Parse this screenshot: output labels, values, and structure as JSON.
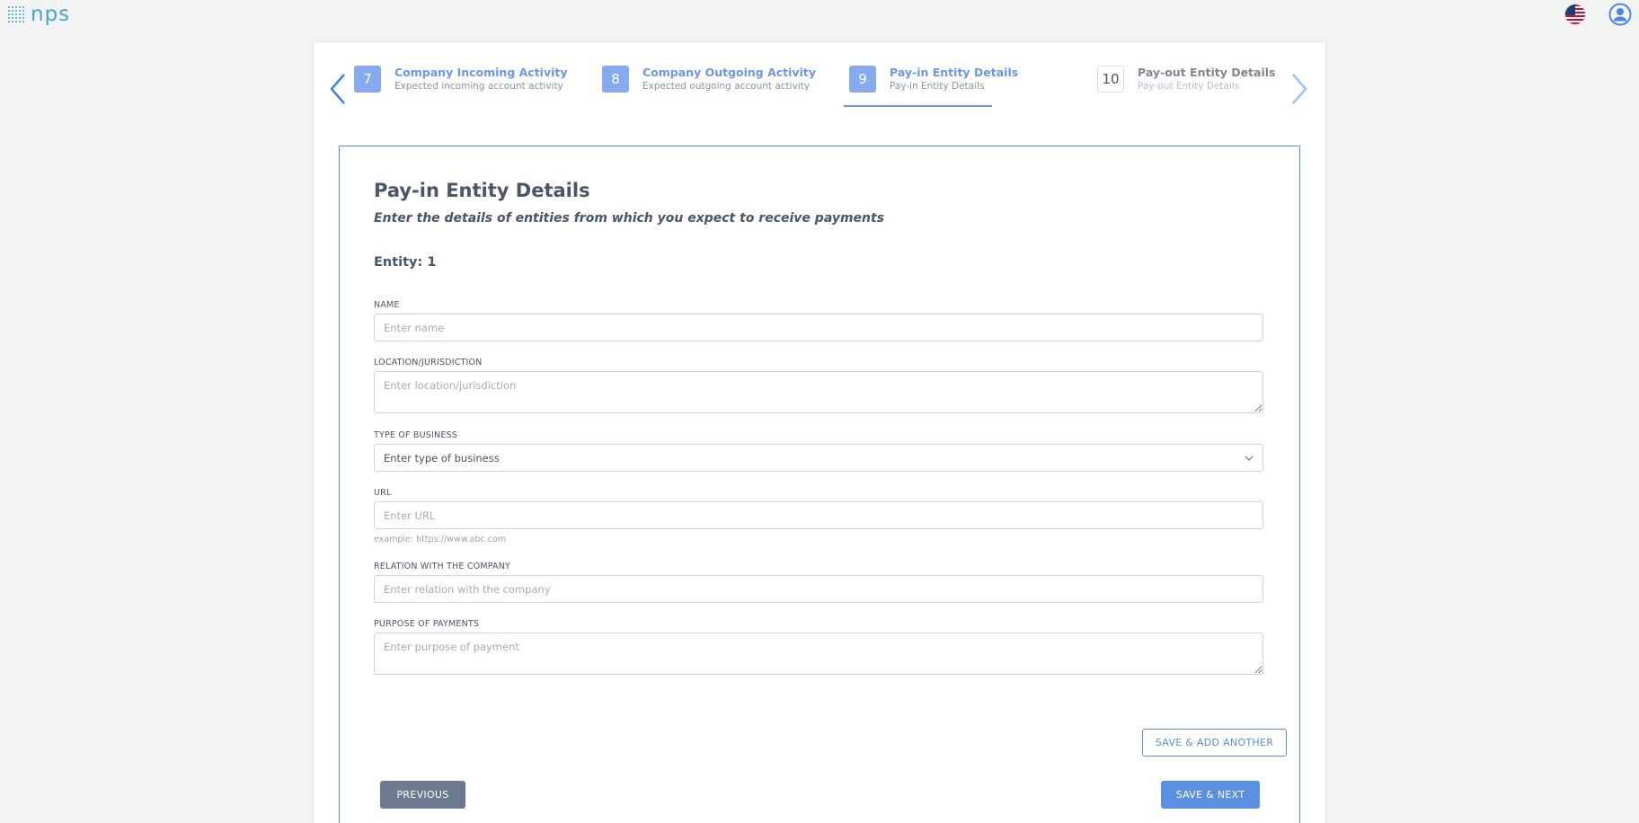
{
  "header": {
    "logo_text": "NPS",
    "flag_icon": "us-flag-icon",
    "user_icon": "user-avatar-icon"
  },
  "stepper": {
    "steps": [
      {
        "number": "7",
        "title": "Company Incoming Activity",
        "subtitle": "Expected incoming account activity",
        "state": "complete"
      },
      {
        "number": "8",
        "title": "Company Outgoing Activity",
        "subtitle": "Expected outgoing account activity",
        "state": "complete"
      },
      {
        "number": "9",
        "title": "Pay-in Entity Details",
        "subtitle": "Pay-in Entity Details",
        "state": "active"
      },
      {
        "number": "10",
        "title": "Pay-out Entity Details",
        "subtitle": "Pay-out Entity Details",
        "state": "inactive"
      }
    ]
  },
  "form": {
    "title": "Pay-in Entity Details",
    "subtitle": "Enter the details of entities from which you expect to receive payments",
    "entity_label": "Entity: 1",
    "name": {
      "label": "NAME",
      "placeholder": "Enter name",
      "value": ""
    },
    "location": {
      "label": "LOCATION/JURISDICTION",
      "placeholder": "Enter location/jurisdiction",
      "value": ""
    },
    "business_type": {
      "label": "TYPE OF BUSINESS",
      "selected": "Enter type of business"
    },
    "url": {
      "label": "URL",
      "placeholder": "Enter URL",
      "value": "",
      "hint": "example: https://www.abc.com"
    },
    "relation": {
      "label": "RELATION WITH THE COMPANY",
      "placeholder": "Enter relation with the company",
      "value": ""
    },
    "purpose": {
      "label": "PURPOSE OF PAYMENTS",
      "placeholder": "Enter purpose of payment",
      "value": ""
    },
    "save_add_label": "SAVE & ADD ANOTHER",
    "previous_label": "PREVIOUS",
    "save_next_label": "SAVE & NEXT"
  },
  "colors": {
    "accent": "#5b8fd8",
    "step_active": "#86a9f0",
    "previous_button": "#6b7a8f"
  }
}
